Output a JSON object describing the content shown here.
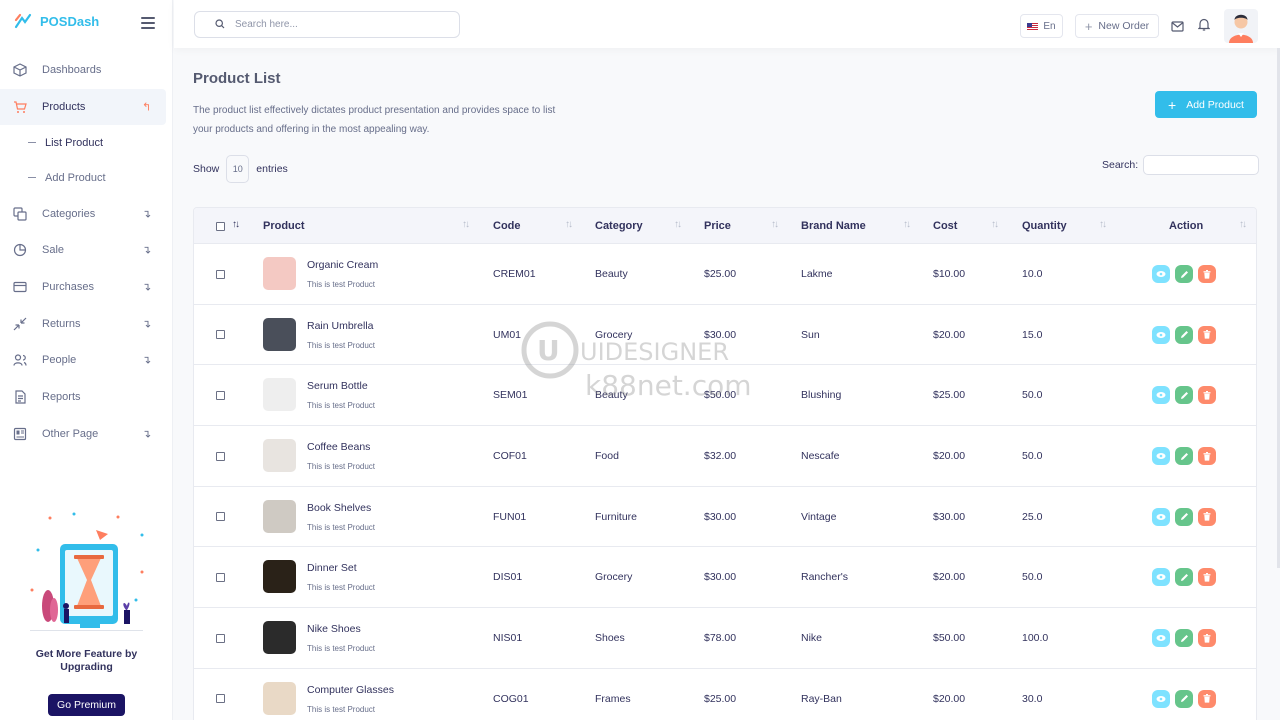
{
  "brand": {
    "name": "POSDash",
    "accent": "#32bdea"
  },
  "sidebar": {
    "items": [
      {
        "label": "Dashboards",
        "icon": "cube-icon"
      },
      {
        "label": "Products",
        "icon": "cart-icon"
      },
      {
        "label": "Categories",
        "icon": "copy-icon"
      },
      {
        "label": "Sale",
        "icon": "pie-icon"
      },
      {
        "label": "Purchases",
        "icon": "card-icon"
      },
      {
        "label": "Returns",
        "icon": "arrows-icon"
      },
      {
        "label": "People",
        "icon": "users-icon"
      },
      {
        "label": "Reports",
        "icon": "file-icon"
      },
      {
        "label": "Other Page",
        "icon": "layout-icon"
      }
    ],
    "products_sub": [
      {
        "label": "List Product"
      },
      {
        "label": "Add Product"
      }
    ],
    "promo": {
      "text": "Get More Feature by Upgrading",
      "button": "Go Premium"
    }
  },
  "topbar": {
    "search_placeholder": "Search here...",
    "language": "En",
    "new_order": "New Order"
  },
  "page": {
    "title": "Product List",
    "description": "The product list effectively dictates product presentation and provides space to list your products and offering in the most appealing way.",
    "add_button": "Add Product",
    "show_label": "Show",
    "entries_value": "10",
    "entries_label": "entries",
    "search_label": "Search:"
  },
  "table": {
    "headers": [
      "Product",
      "Code",
      "Category",
      "Price",
      "Brand Name",
      "Cost",
      "Quantity",
      "Action"
    ],
    "rows": [
      {
        "name": "Organic Cream",
        "sub": "This is test Product",
        "code": "CREM01",
        "category": "Beauty",
        "price": "$25.00",
        "brand": "Lakme",
        "cost": "$10.00",
        "qty": "10.0",
        "thumb": "#f4c9c3"
      },
      {
        "name": "Rain Umbrella",
        "sub": "This is test Product",
        "code": "UM01",
        "category": "Grocery",
        "price": "$30.00",
        "brand": "Sun",
        "cost": "$20.00",
        "qty": "15.0",
        "thumb": "#4a4f5a"
      },
      {
        "name": "Serum Bottle",
        "sub": "This is test Product",
        "code": "SEM01",
        "category": "Beauty",
        "price": "$50.00",
        "brand": "Blushing",
        "cost": "$25.00",
        "qty": "50.0",
        "thumb": "#eeeeee"
      },
      {
        "name": "Coffee Beans",
        "sub": "This is test Product",
        "code": "COF01",
        "category": "Food",
        "price": "$32.00",
        "brand": "Nescafe",
        "cost": "$20.00",
        "qty": "50.0",
        "thumb": "#e8e4e0"
      },
      {
        "name": "Book Shelves",
        "sub": "This is test Product",
        "code": "FUN01",
        "category": "Furniture",
        "price": "$30.00",
        "brand": "Vintage",
        "cost": "$30.00",
        "qty": "25.0",
        "thumb": "#cfcac3"
      },
      {
        "name": "Dinner Set",
        "sub": "This is test Product",
        "code": "DIS01",
        "category": "Grocery",
        "price": "$30.00",
        "brand": "Rancher's",
        "cost": "$20.00",
        "qty": "50.0",
        "thumb": "#2a2218"
      },
      {
        "name": "Nike Shoes",
        "sub": "This is test Product",
        "code": "NIS01",
        "category": "Shoes",
        "price": "$78.00",
        "brand": "Nike",
        "cost": "$50.00",
        "qty": "100.0",
        "thumb": "#2b2b2b"
      },
      {
        "name": "Computer Glasses",
        "sub": "This is test Product",
        "code": "COG01",
        "category": "Frames",
        "price": "$25.00",
        "brand": "Ray-Ban",
        "cost": "$20.00",
        "qty": "30.0",
        "thumb": "#e9d9c6"
      }
    ]
  },
  "watermark": {
    "line1": "UIDESIGNER",
    "line2": "k88net.com"
  }
}
